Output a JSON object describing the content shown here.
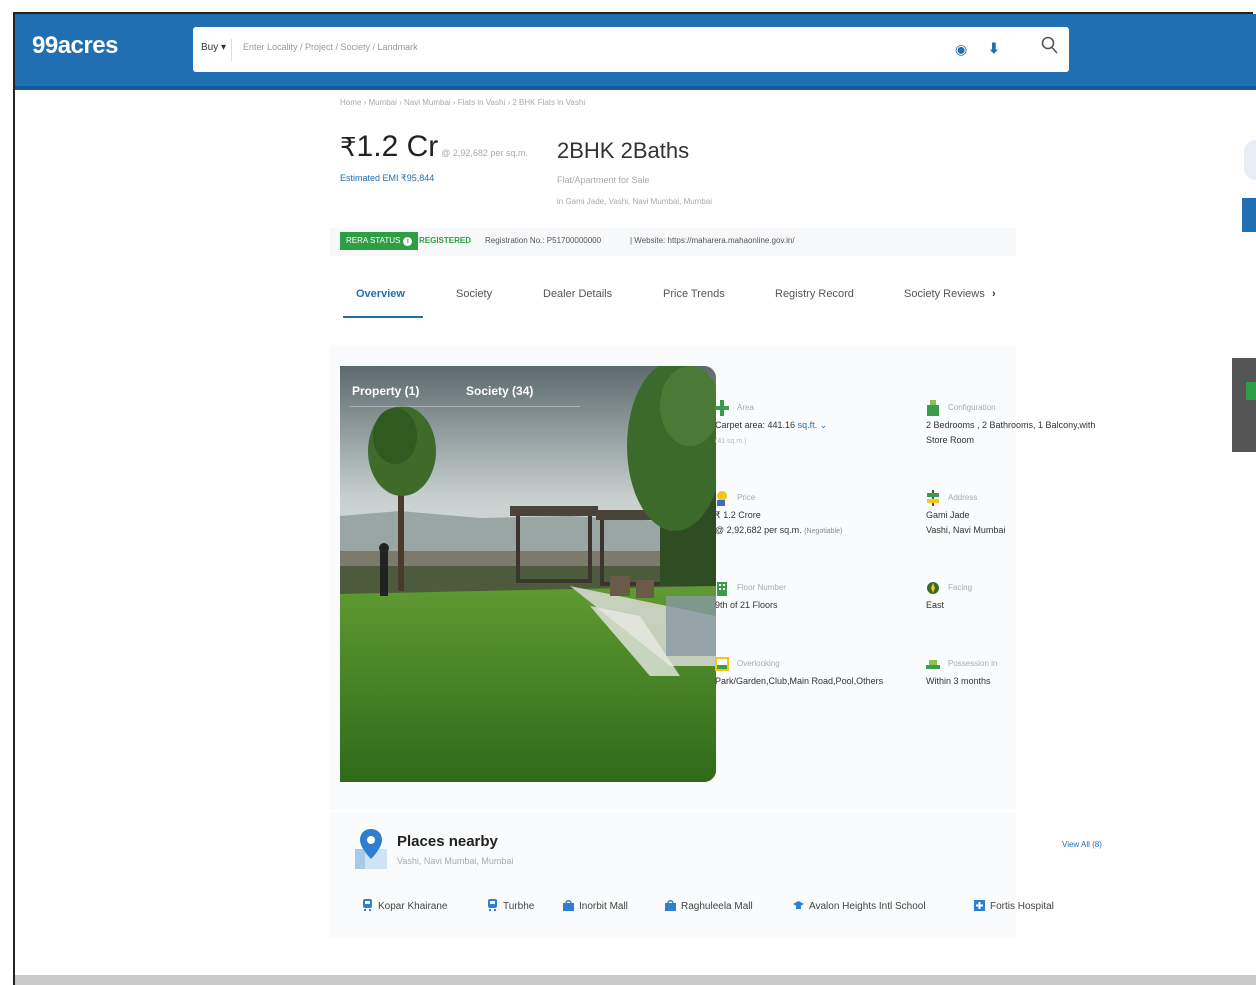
{
  "header": {
    "logo": "99acres",
    "buy_label": "Buy ▾",
    "search_placeholder": "Enter Locality / Project / Society / Landmark"
  },
  "breadcrumb": "Home › Mumbai › Navi Mumbai › Flats in Vashi › 2 BHK Flats in Vashi",
  "listing": {
    "price_symbol": "₹",
    "price": "1.2 Cr",
    "price_per_sqm": "@ 2,92,682 per sq.m.",
    "emi": "Estimated EMI ₹95,844",
    "title": "2BHK 2Baths",
    "type": "Flat/Apartment for Sale",
    "location": "in Gami Jade, Vashi, Navi Mumbai, Mumbai"
  },
  "rera": {
    "badge": "RERA STATUS",
    "status": "REGISTERED",
    "registration": "Registration No.: P51700000000",
    "website": "|  Website: https://maharera.mahaonline.gov.in/"
  },
  "tabs": [
    "Overview",
    "Society",
    "Dealer Details",
    "Price Trends",
    "Registry Record",
    "Society Reviews"
  ],
  "tabs_more": "›",
  "gallery": {
    "tabs": [
      "Property (1)",
      "Society (34)"
    ]
  },
  "details": {
    "area": {
      "label": "Area",
      "value": "Carpet area: 441.16",
      "unit": "sq.ft. ⌄",
      "sub": "(41 sq.m.)"
    },
    "configuration": {
      "label": "Configuration",
      "value": "2 Bedrooms , 2 Bathrooms, 1 Balcony,with",
      "value2": "Store Room"
    },
    "price": {
      "label": "Price",
      "value": "₹ 1.2 Crore",
      "value2": "@ 2,92,682 per sq.m.",
      "negotiable": "(Negotiable)"
    },
    "address": {
      "label": "Address",
      "value": "Gami Jade",
      "value2": "Vashi, Navi Mumbai"
    },
    "floor": {
      "label": "Floor Number",
      "value": "9th of 21 Floors"
    },
    "facing": {
      "label": "Facing",
      "value": "East"
    },
    "overlooking": {
      "label": "Overlooking",
      "value": "Park/Garden,Club,Main Road,Pool,Others"
    },
    "possession": {
      "label": "Possession in",
      "value": "Within 3 months"
    }
  },
  "places": {
    "title": "Places nearby",
    "subtitle": "Vashi, Navi Mumbai, Mumbai",
    "view_all": "View All (8)",
    "items": [
      "Kopar Khairane",
      "Turbhe",
      "Inorbit Mall",
      "Raghuleela Mall",
      "Avalon Heights Intl School",
      "Fortis Hospital"
    ]
  },
  "colors": {
    "brand": "#1f6fb2",
    "rera_green": "#2e9e44"
  }
}
